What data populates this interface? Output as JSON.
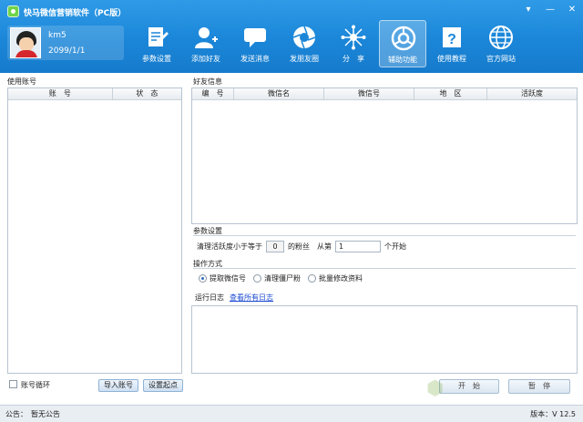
{
  "window": {
    "title": "快马微信营销软件（PC版）",
    "min_label": "▾",
    "minimize_label": "—",
    "close_label": "✕"
  },
  "profile": {
    "username": "km5",
    "expiry": "2099/1/1"
  },
  "toolbar": {
    "items": [
      {
        "label": "参数设置",
        "icon": "document-edit-icon",
        "active": false
      },
      {
        "label": "添加好友",
        "icon": "add-user-icon",
        "active": false
      },
      {
        "label": "发送消息",
        "icon": "chat-bubble-icon",
        "active": false
      },
      {
        "label": "发朋友圈",
        "icon": "camera-shutter-icon",
        "active": false
      },
      {
        "label": "分　享",
        "icon": "share-network-icon",
        "active": false
      },
      {
        "label": "辅助功能",
        "icon": "support-headset-icon",
        "active": true
      },
      {
        "label": "使用教程",
        "icon": "help-book-icon",
        "active": false
      },
      {
        "label": "官方网站",
        "icon": "globe-icon",
        "active": false
      }
    ]
  },
  "accounts": {
    "title": "使用账号",
    "columns": [
      "账　号",
      "状　态"
    ],
    "loop_label": "账号循环",
    "import_button": "导入账号",
    "set_start_button": "设置起点"
  },
  "friends": {
    "title": "好友信息",
    "columns": [
      "编　号",
      "微信名",
      "微信号",
      "地　区",
      "活跃度"
    ]
  },
  "params": {
    "title": "参数设置",
    "text_prefix": "清理活跃度小于等于",
    "threshold_value": "0",
    "text_middle": "的粉丝　从第",
    "start_value": "1",
    "text_suffix": "个开始"
  },
  "operation": {
    "title": "操作方式",
    "options": [
      {
        "label": "提取微信号",
        "selected": true
      },
      {
        "label": "清理僵尸粉",
        "selected": false
      },
      {
        "label": "批量修改资料",
        "selected": false
      }
    ]
  },
  "log": {
    "title": "运行日志",
    "view_all_link": "查看所有日志"
  },
  "actions": {
    "start_button": "开　始",
    "pause_button": "暂　停"
  },
  "status": {
    "notice": "公告：　暂无公告",
    "version": "版本：V 12.5"
  },
  "colors": {
    "header": "#1b86d8",
    "accent_link": "#1b4ad1"
  }
}
